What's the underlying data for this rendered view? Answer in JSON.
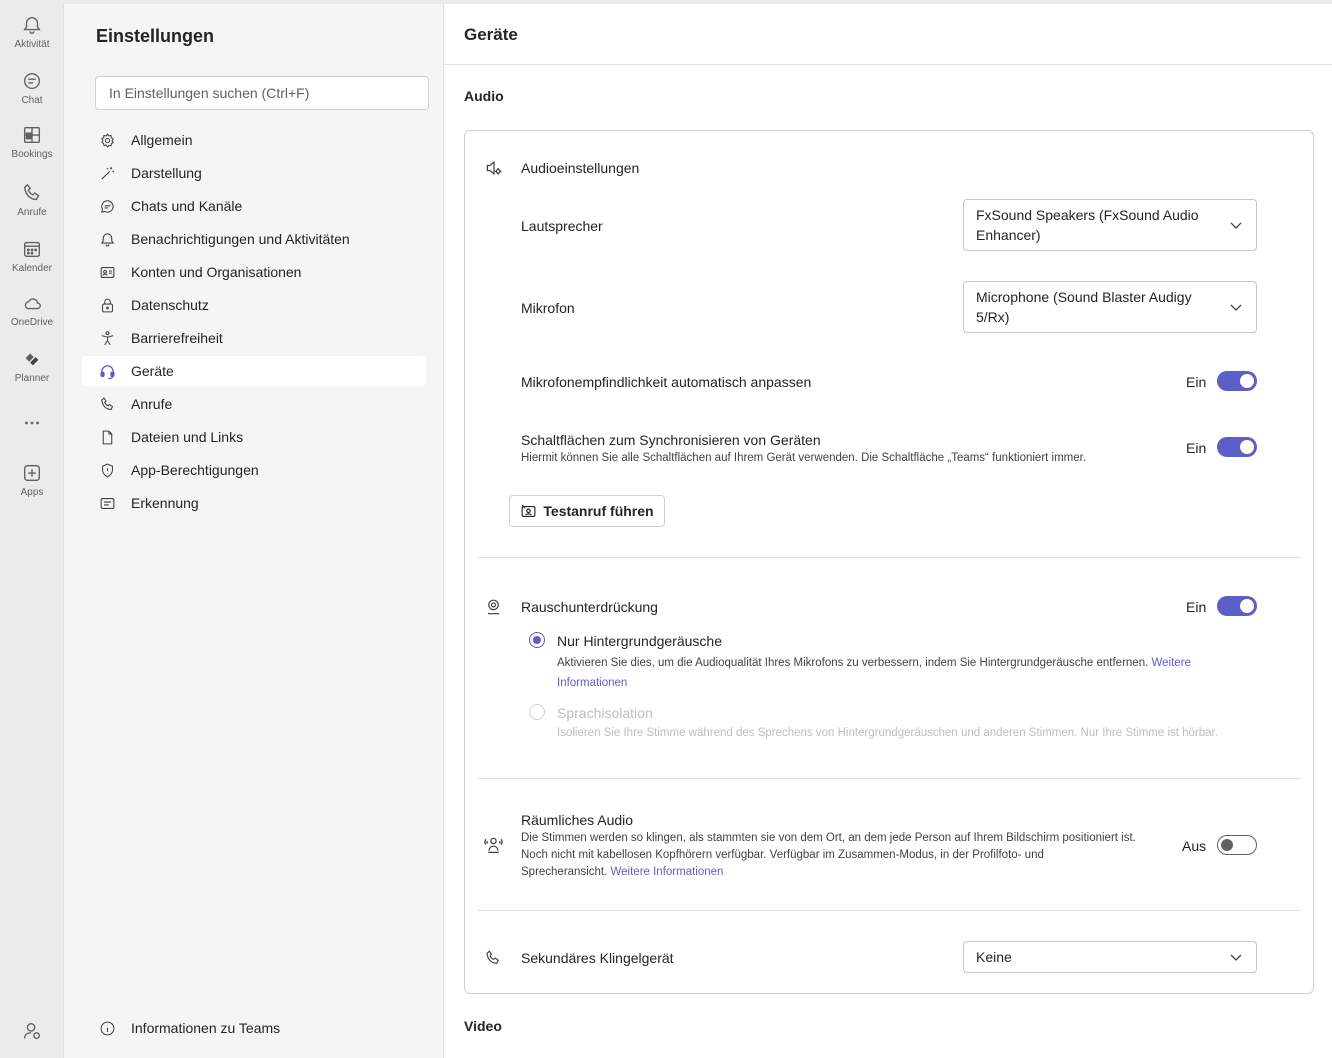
{
  "rail": {
    "items": [
      {
        "label": "Aktivität",
        "icon": "bell-icon"
      },
      {
        "label": "Chat",
        "icon": "chat-icon"
      },
      {
        "label": "Bookings",
        "icon": "bookings-icon"
      },
      {
        "label": "Anrufe",
        "icon": "phone-icon"
      },
      {
        "label": "Kalender",
        "icon": "calendar-icon"
      },
      {
        "label": "OneDrive",
        "icon": "cloud-icon"
      },
      {
        "label": "Planner",
        "icon": "planner-icon"
      },
      {
        "label": "",
        "icon": "more-icon"
      },
      {
        "label": "Apps",
        "icon": "add-apps-icon"
      }
    ]
  },
  "nav": {
    "title": "Einstellungen",
    "search_placeholder": "In Einstellungen suchen (Ctrl+F)",
    "items": [
      {
        "label": "Allgemein",
        "icon": "gear-icon"
      },
      {
        "label": "Darstellung",
        "icon": "wand-icon"
      },
      {
        "label": "Chats und Kanäle",
        "icon": "chat-bubble-icon"
      },
      {
        "label": "Benachrichtigungen und Aktivitäten",
        "icon": "bell-icon"
      },
      {
        "label": "Konten und Organisationen",
        "icon": "contact-card-icon"
      },
      {
        "label": "Datenschutz",
        "icon": "lock-icon"
      },
      {
        "label": "Barrierefreiheit",
        "icon": "accessibility-icon"
      },
      {
        "label": "Geräte",
        "icon": "headset-icon"
      },
      {
        "label": "Anrufe",
        "icon": "phone-icon"
      },
      {
        "label": "Dateien und Links",
        "icon": "document-icon"
      },
      {
        "label": "App-Berechtigungen",
        "icon": "shield-icon"
      },
      {
        "label": "Erkennung",
        "icon": "text-box-icon"
      }
    ],
    "active": "Geräte",
    "footer_label": "Informationen zu Teams"
  },
  "main": {
    "title": "Geräte",
    "audio_section": "Audio",
    "video_section": "Video",
    "audio_settings": {
      "heading": "Audioeinstellungen",
      "speaker_label": "Lautsprecher",
      "speaker_value": "FxSound Speakers (FxSound Audio Enhancer)",
      "mic_label": "Mikrofon",
      "mic_value": "Microphone (Sound Blaster Audigy 5/Rx)",
      "auto_sensitivity_label": "Mikrofonempfindlichkeit automatisch anpassen",
      "auto_sensitivity_state": "Ein",
      "sync_buttons_label": "Schaltflächen zum Synchronisieren von Geräten",
      "sync_buttons_desc": "Hiermit können Sie alle Schaltflächen auf Ihrem Gerät verwenden. Die Schaltfläche „Teams“ funktioniert immer.",
      "sync_buttons_state": "Ein",
      "test_call_button": "Testanruf führen"
    },
    "noise": {
      "heading": "Rauschunterdrückung",
      "state": "Ein",
      "option1_label": "Nur Hintergrundgeräusche",
      "option1_desc": "Aktivieren Sie dies, um die Audioqualität Ihres Mikrofons zu verbessern, indem Sie Hintergrundgeräusche entfernen.",
      "option1_link_a": "Weitere",
      "option1_link_b": "Informationen",
      "option2_label": "Sprachisolation",
      "option2_desc": "Isolieren Sie Ihre Stimme während des Sprechens von Hintergrundgeräuschen und anderen Stimmen. Nur Ihre Stimme ist hörbar."
    },
    "spatial": {
      "heading": "Räumliches Audio",
      "desc_line1": "Die Stimmen werden so klingen, als stammten sie von dem Ort, an dem jede Person auf Ihrem Bildschirm positioniert ist.",
      "desc_line2": "Noch nicht mit kabellosen Kopfhörern verfügbar. Verfügbar im Zusammen-Modus, in der Profilfoto- und",
      "desc_line3": "Sprecheransicht.",
      "link": "Weitere Informationen",
      "state": "Aus"
    },
    "secondary_ringer": {
      "label": "Sekundäres Klingelgerät",
      "value": "Keine"
    }
  },
  "colors": {
    "accent": "#5b5fc7",
    "rail_bg": "#ebebeb",
    "nav_bg": "#f5f5f5"
  }
}
